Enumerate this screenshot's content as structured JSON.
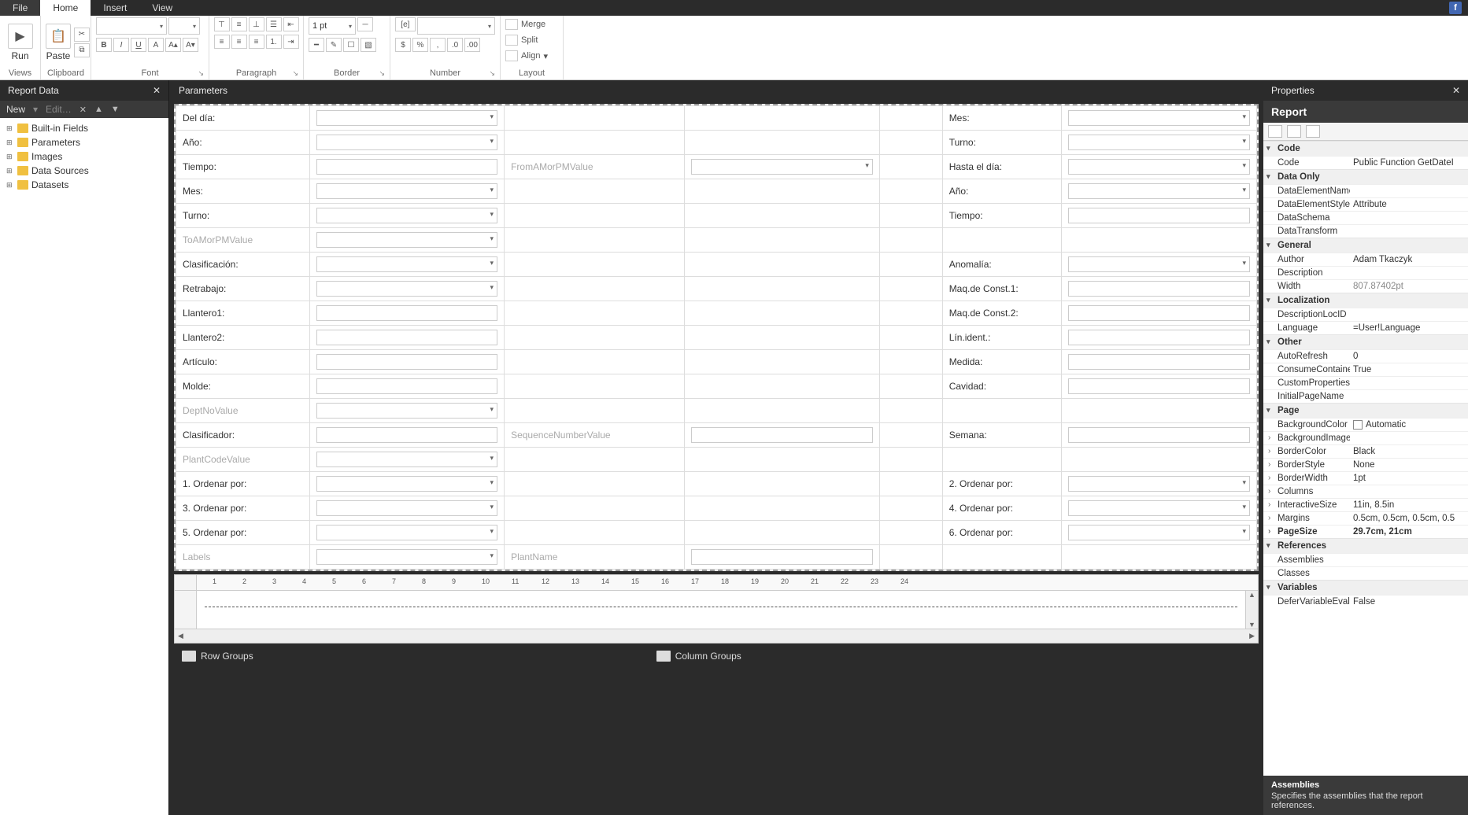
{
  "tabs": {
    "file": "File",
    "home": "Home",
    "insert": "Insert",
    "view": "View"
  },
  "ribbon": {
    "run": "Run",
    "views": "Views",
    "paste": "Paste",
    "clipboard": "Clipboard",
    "font_group": "Font",
    "paragraph_group": "Paragraph",
    "border_group": "Border",
    "border_width": "1 pt",
    "number_group": "Number",
    "layout_group": "Layout",
    "merge": "Merge",
    "split": "Split",
    "align": "Align"
  },
  "reportData": {
    "title": "Report Data",
    "new": "New",
    "edit": "Edit…",
    "items": [
      "Built-in Fields",
      "Parameters",
      "Images",
      "Data Sources",
      "Datasets"
    ]
  },
  "params": {
    "title": "Parameters",
    "rows": [
      {
        "l1": "Del día:",
        "d1": true,
        "ml": "",
        "mc": false,
        "l2": "Mes:",
        "d2": true
      },
      {
        "l1": "Año:",
        "d1": true,
        "ml": "",
        "mc": false,
        "l2": "Turno:",
        "d2": true
      },
      {
        "l1": "Tiempo:",
        "d1": false,
        "ml": "FromAMorPMValue",
        "mc": true,
        "mcd": true,
        "l2": "Hasta el día:",
        "d2": true
      },
      {
        "l1": "Mes:",
        "d1": true,
        "ml": "",
        "mc": false,
        "l2": "Año:",
        "d2": true
      },
      {
        "l1": "Turno:",
        "d1": true,
        "ml": "",
        "mc": false,
        "l2": "Tiempo:",
        "d2": false
      },
      {
        "l1": "ToAMorPMValue",
        "l1dim": true,
        "d1": true,
        "ml": "",
        "mc": false,
        "l2": "",
        "d2": null
      },
      {
        "l1": "Clasificación:",
        "d1": true,
        "ml": "",
        "mc": false,
        "l2": "Anomalía:",
        "d2": true
      },
      {
        "l1": "Retrabajo:",
        "d1": true,
        "ml": "",
        "mc": false,
        "l2": "Maq.de Const.1:",
        "d2": false
      },
      {
        "l1": "Llantero1:",
        "d1": false,
        "ml": "",
        "mc": false,
        "l2": "Maq.de Const.2:",
        "d2": false
      },
      {
        "l1": "Llantero2:",
        "d1": false,
        "ml": "",
        "mc": false,
        "l2": "Lín.ident.:",
        "d2": false
      },
      {
        "l1": "Artículo:",
        "d1": false,
        "ml": "",
        "mc": false,
        "l2": "Medida:",
        "d2": false
      },
      {
        "l1": "Molde:",
        "d1": false,
        "ml": "",
        "mc": false,
        "l2": "Cavidad:",
        "d2": false
      },
      {
        "l1": "DeptNoValue",
        "l1dim": true,
        "d1": true,
        "ml": "",
        "mc": false,
        "l2": "",
        "d2": null
      },
      {
        "l1": "Clasificador:",
        "d1": false,
        "ml": "SequenceNumberValue",
        "mc": true,
        "mcd": false,
        "l2": "Semana:",
        "d2": false
      },
      {
        "l1": "PlantCodeValue",
        "l1dim": true,
        "d1": true,
        "ml": "",
        "mc": false,
        "l2": "",
        "d2": null
      },
      {
        "l1": "1. Ordenar por:",
        "d1": true,
        "ml": "",
        "mc": false,
        "l2": "2. Ordenar por:",
        "d2": true
      },
      {
        "l1": "3. Ordenar por:",
        "d1": true,
        "ml": "",
        "mc": false,
        "l2": "4. Ordenar por:",
        "d2": true
      },
      {
        "l1": "5. Ordenar por:",
        "d1": true,
        "ml": "",
        "mc": false,
        "l2": "6. Ordenar por:",
        "d2": true
      },
      {
        "l1": "Labels",
        "l1dim": true,
        "d1": true,
        "ml": "PlantName",
        "mc": true,
        "mcd": false,
        "l2": "",
        "d2": null
      }
    ]
  },
  "ruler": [
    "1",
    "2",
    "3",
    "4",
    "5",
    "6",
    "7",
    "8",
    "9",
    "10",
    "11",
    "12",
    "13",
    "14",
    "15",
    "16",
    "17",
    "18",
    "19",
    "20",
    "21",
    "22",
    "23",
    "24"
  ],
  "groups": {
    "row": "Row Groups",
    "col": "Column Groups"
  },
  "props": {
    "title": "Properties",
    "object": "Report",
    "cats": [
      {
        "name": "Code",
        "rows": [
          {
            "n": "Code",
            "v": "Public Function GetDateI"
          }
        ]
      },
      {
        "name": "Data Only",
        "rows": [
          {
            "n": "DataElementName",
            "v": ""
          },
          {
            "n": "DataElementStyle",
            "v": "Attribute"
          },
          {
            "n": "DataSchema",
            "v": ""
          },
          {
            "n": "DataTransform",
            "v": ""
          }
        ]
      },
      {
        "name": "General",
        "rows": [
          {
            "n": "Author",
            "v": "Adam Tkaczyk"
          },
          {
            "n": "Description",
            "v": ""
          },
          {
            "n": "Width",
            "v": "807.87402pt",
            "dim": true
          }
        ]
      },
      {
        "name": "Localization",
        "rows": [
          {
            "n": "DescriptionLocID",
            "v": ""
          },
          {
            "n": "Language",
            "v": "=User!Language"
          }
        ]
      },
      {
        "name": "Other",
        "rows": [
          {
            "n": "AutoRefresh",
            "v": "0"
          },
          {
            "n": "ConsumeContainerW",
            "v": "True"
          },
          {
            "n": "CustomProperties",
            "v": ""
          },
          {
            "n": "InitialPageName",
            "v": ""
          }
        ]
      },
      {
        "name": "Page",
        "rows": [
          {
            "n": "BackgroundColor",
            "v": "Automatic",
            "swatch": true
          },
          {
            "n": "BackgroundImage",
            "v": "",
            "exp": true
          },
          {
            "n": "BorderColor",
            "v": "Black",
            "exp": true
          },
          {
            "n": "BorderStyle",
            "v": "None",
            "exp": true
          },
          {
            "n": "BorderWidth",
            "v": "1pt",
            "exp": true
          },
          {
            "n": "Columns",
            "v": "",
            "exp": true
          },
          {
            "n": "InteractiveSize",
            "v": "11in, 8.5in",
            "exp": true
          },
          {
            "n": "Margins",
            "v": "0.5cm, 0.5cm, 0.5cm, 0.5",
            "exp": true
          },
          {
            "n": "PageSize",
            "v": "29.7cm, 21cm",
            "exp": true,
            "bold": true
          }
        ]
      },
      {
        "name": "References",
        "rows": [
          {
            "n": "Assemblies",
            "v": ""
          },
          {
            "n": "Classes",
            "v": ""
          }
        ]
      },
      {
        "name": "Variables",
        "rows": [
          {
            "n": "DeferVariableEvaluati",
            "v": "False"
          }
        ]
      }
    ],
    "footer_title": "Assemblies",
    "footer_desc": "Specifies the assemblies that the report references."
  }
}
